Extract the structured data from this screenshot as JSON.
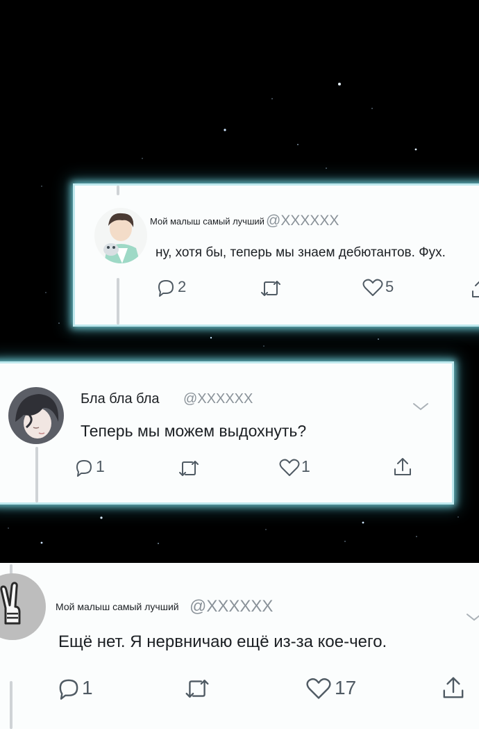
{
  "tweets": [
    {
      "author_name": "Мой малыш самый лучший",
      "handle": "@XXXXXX",
      "text": "ну, хотя бы, теперь мы знаем дебютантов. Фух.",
      "reply_count": "2",
      "like_count": "5",
      "avatar_icon": "avatar-boy-with-cat-icon"
    },
    {
      "author_name": "Бла бла бла",
      "handle": "@XXXXXX",
      "text": "Теперь мы можем выдохнуть?",
      "reply_count": "1",
      "like_count": "1",
      "avatar_icon": "avatar-dark-haired-boy-icon"
    },
    {
      "author_name": "Мой малыш самый лучший",
      "handle": "@XXXXXX",
      "text": "Ещё нет. Я нервничаю ещё из-за кое-чего.",
      "reply_count": "1",
      "like_count": "17",
      "avatar_icon": "avatar-peace-hand-icon"
    }
  ],
  "colors": {
    "background": "#000000",
    "card": "#fbfdfd",
    "glow": "#7fd6df",
    "icon": "#4f5a63",
    "handle": "#8a9299"
  }
}
